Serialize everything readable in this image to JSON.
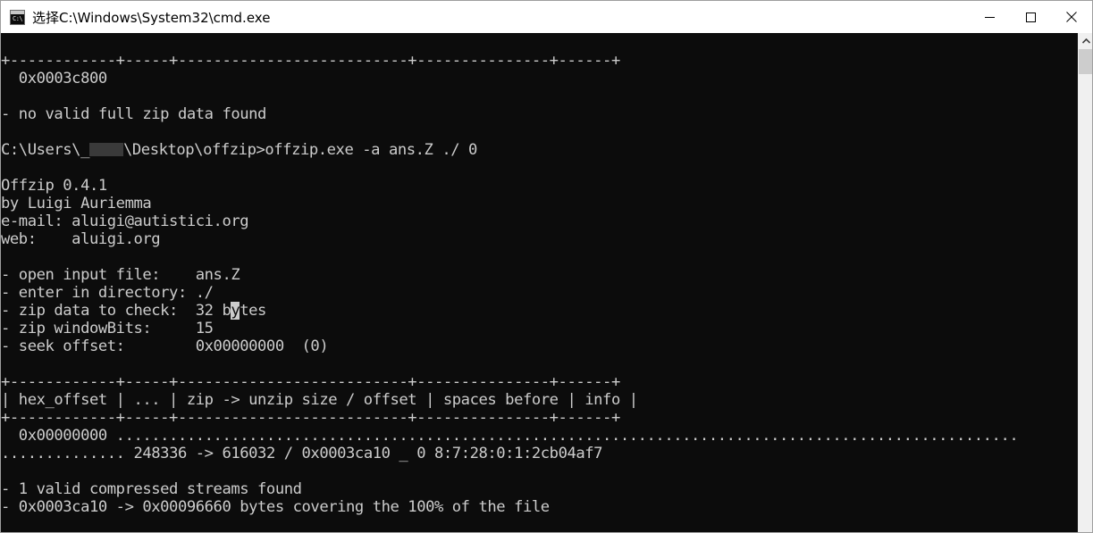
{
  "window": {
    "title": "选择C:\\Windows\\System32\\cmd.exe",
    "icon": "cmd-icon",
    "icon_glyph": "C:\\",
    "controls": {
      "minimize": "Minimize",
      "maximize": "Maximize",
      "close": "Close"
    }
  },
  "scrollbar": {
    "up_arrow": "scroll-up",
    "thumb": "scroll-thumb"
  },
  "console": {
    "lines": [
      "+------------+-----+--------------------------+---------------+------+",
      "  0x0003c800",
      "",
      "- no valid full zip data found",
      "",
      "C:\\Users\\_",
      "",
      "Offzip 0.4.1",
      "by Luigi Auriemma",
      "e-mail: aluigi@autistici.org",
      "web:    aluigi.org",
      "",
      "- open input file:    ans.Z",
      "- enter in directory: ./",
      "- zip data to check:  32 b",
      "- zip windowBits:     15",
      "- seek offset:        0x00000000  (0)",
      "",
      "+------------+-----+--------------------------+---------------+------+",
      "| hex_offset | ... | zip -> unzip size / offset | spaces before | info |",
      "+------------+-----+--------------------------+---------------+------+",
      "  0x00000000 ......................................................................................................",
      ".............. 248336 -> 616032 / 0x0003ca10 _ 0 8:7:28:0:1:2cb04af7",
      "",
      "- 1 valid compressed streams found",
      "- 0x0003ca10 -> 0x00096660 bytes covering the 100% of the file"
    ],
    "prompt_line": {
      "prefix": "C:\\Users\\",
      "redacted": "_",
      "suffix": "\\Desktop\\offzip>",
      "command": "offzip.exe -a ans.Z ./ 0"
    },
    "banner": {
      "name_version": "Offzip 0.4.1",
      "author": "by Luigi Auriemma",
      "email": "e-mail: aluigi@autistici.org",
      "web": "web:    aluigi.org"
    },
    "params": [
      "- open input file:    ans.Z",
      "- enter in directory: ./",
      "- zip windowBits:     15",
      "- seek offset:        0x00000000  (0)"
    ],
    "params_cursor_line": {
      "before": "- zip data to check:  32 b",
      "cursor_char": "y",
      "after": "tes"
    },
    "table": {
      "rule": "+------------+-----+--------------------------+---------------+------+",
      "header": "| hex_offset | ... | zip -> unzip size / offset | spaces before | info |",
      "header_cells": [
        "hex_offset",
        "...",
        "zip -> unzip size / offset",
        "spaces before",
        "info"
      ],
      "row_offset": "  0x00000000 ",
      "row_dots": "......................................................................................................",
      "row_wrap_dots": "..............",
      "row_values": " 248336 -> 616032 / 0x0003ca10 _ 0 8:7:28:0:1:2cb04af7"
    },
    "top_partial": {
      "rule": "+------------+-----+--------------------------+---------------+------+",
      "offset": "  0x0003c800",
      "message": "- no valid full zip data found"
    },
    "summary": {
      "streams": "- 1 valid compressed streams found",
      "coverage": "- 0x0003ca10 -> 0x00096660 bytes covering the 100% of the file"
    },
    "colors": {
      "background": "#0c0c0c",
      "foreground": "#cccccc",
      "cursor": "#cccccc"
    }
  }
}
